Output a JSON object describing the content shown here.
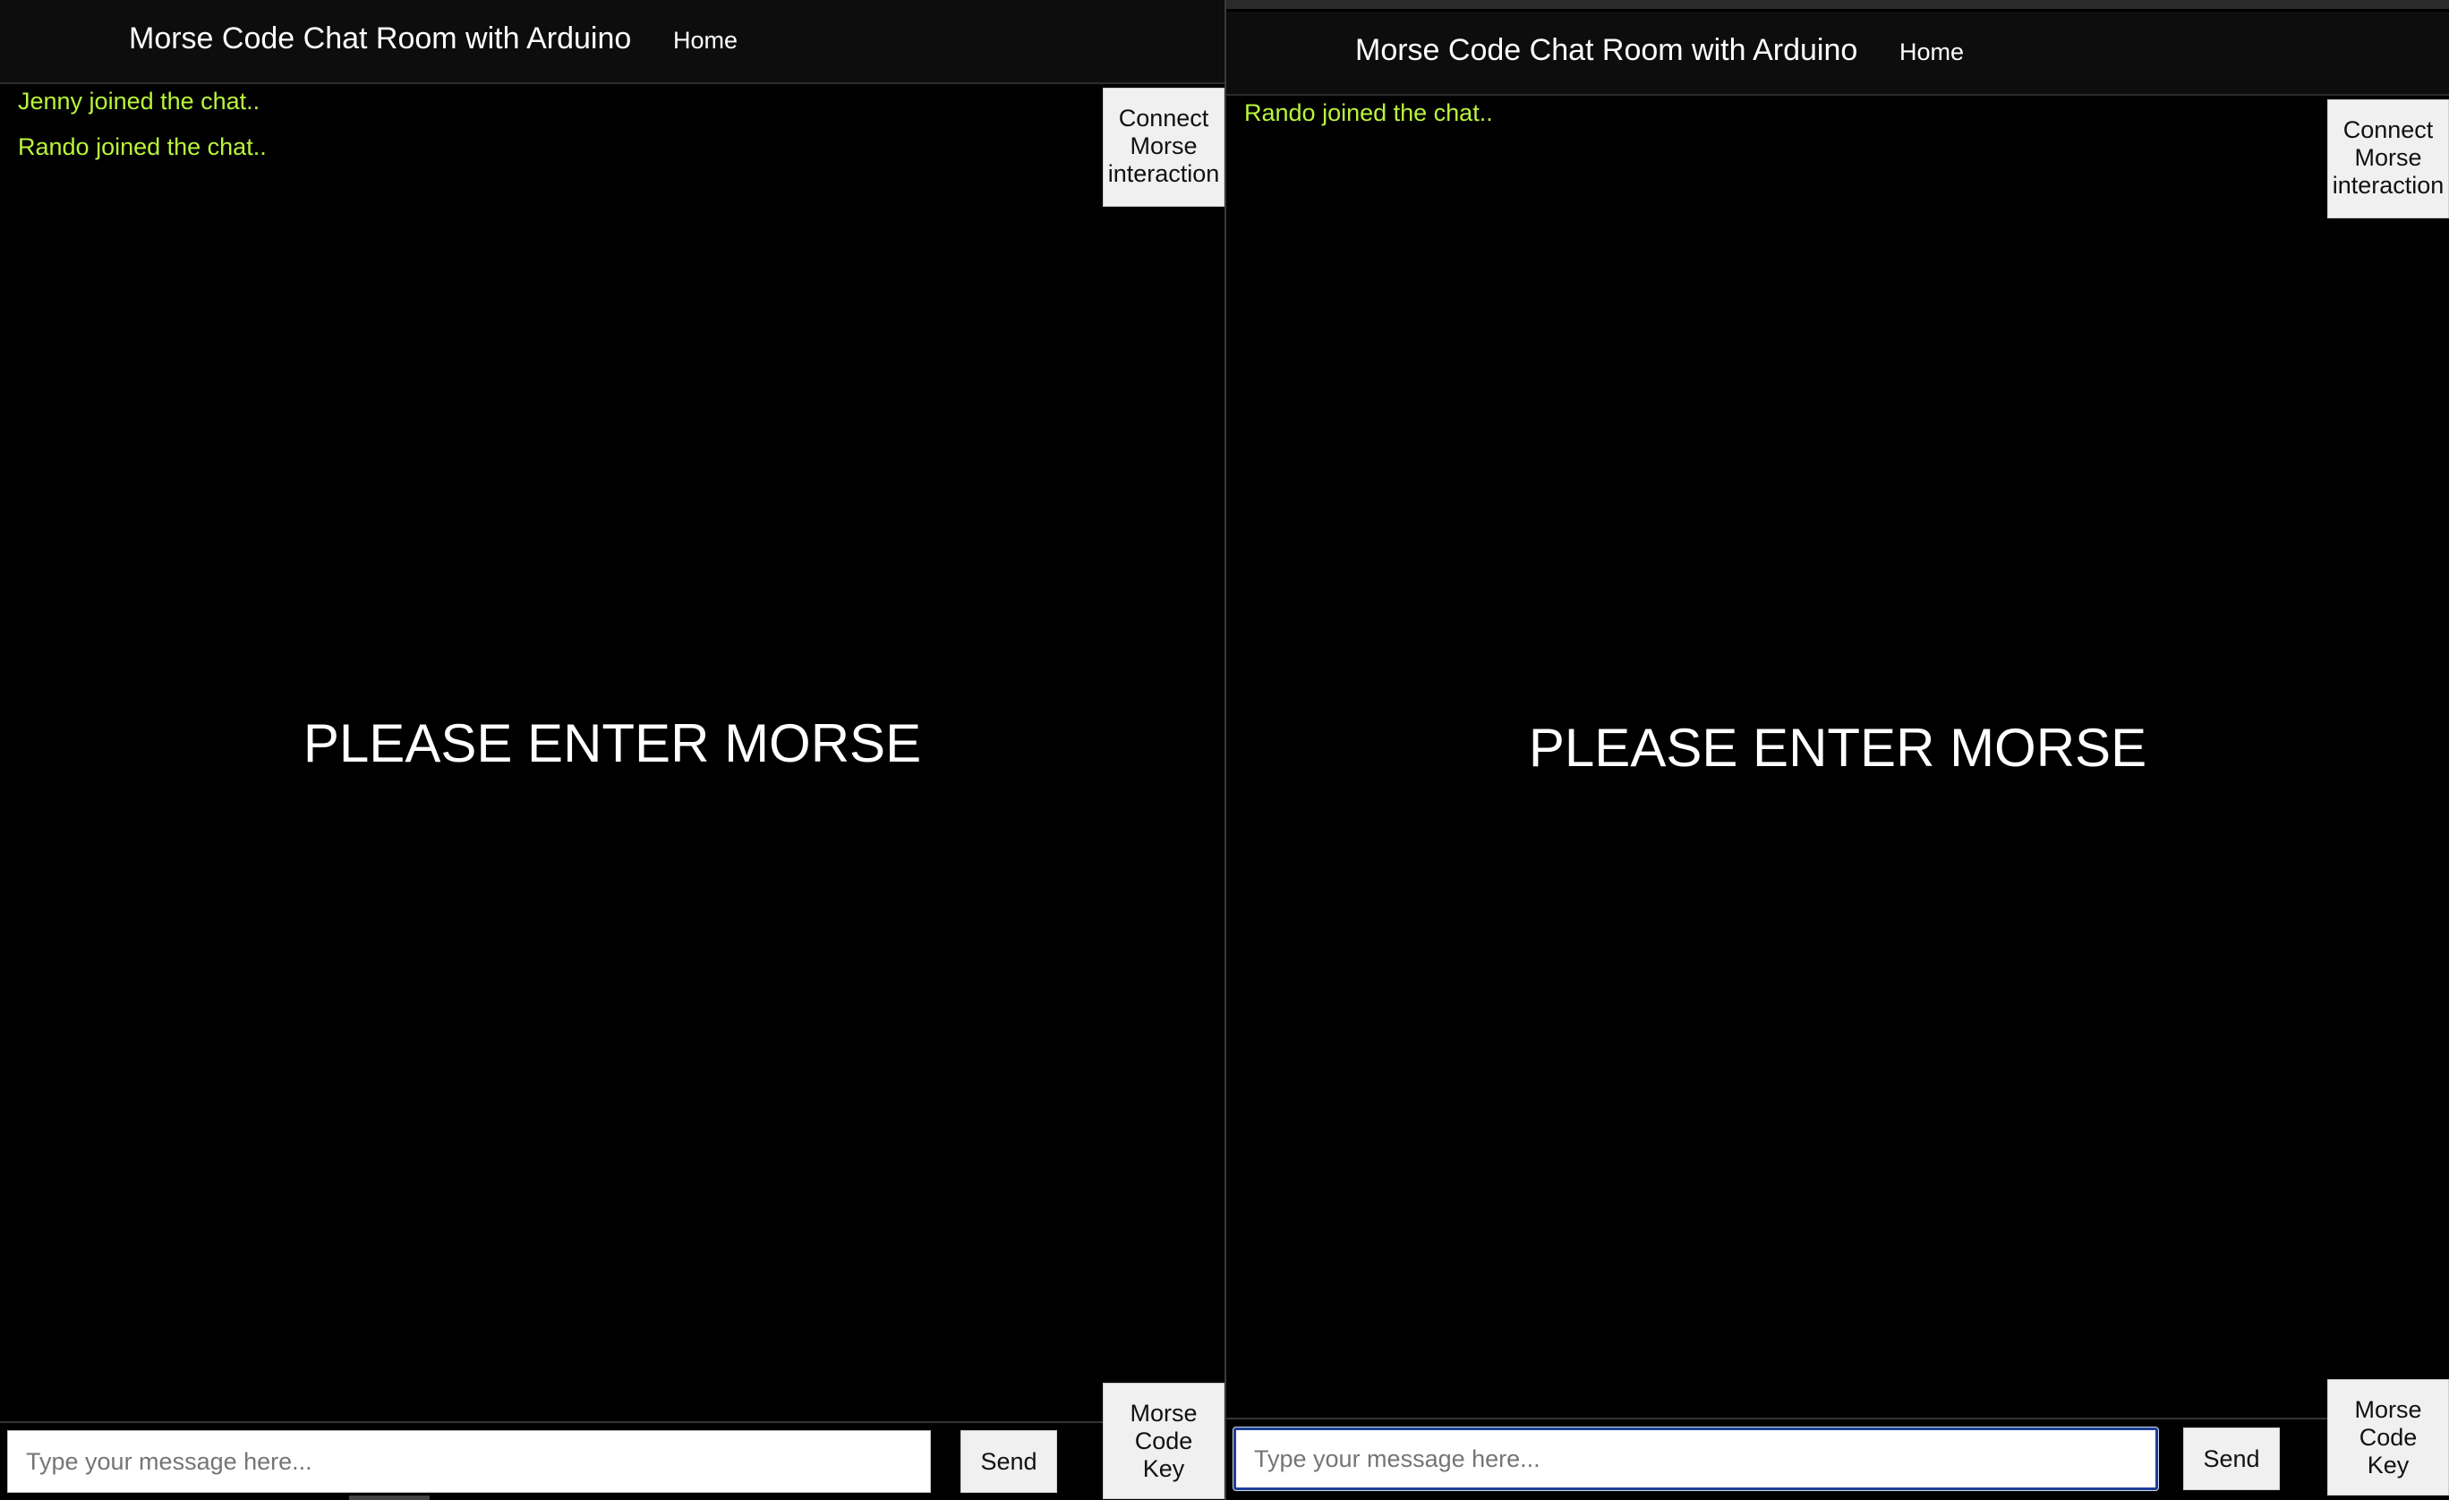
{
  "left_window": {
    "nav": {
      "title": "Morse Code Chat Room with Arduino",
      "home": "Home"
    },
    "messages": [
      "Jenny joined the chat..",
      "Rando joined the chat.."
    ],
    "connect_button": "Connect\nMorse\ninteraction",
    "main_prompt": "PLEASE ENTER MORSE",
    "input": {
      "placeholder": "Type your message here...",
      "value": ""
    },
    "send_button": "Send",
    "key_button": "Morse\nCode\nKey"
  },
  "right_window": {
    "nav": {
      "title": "Morse Code Chat Room with Arduino",
      "home": "Home"
    },
    "messages": [
      "Rando joined the chat.."
    ],
    "connect_button": "Connect\nMorse\ninteraction",
    "main_prompt": "PLEASE ENTER MORSE",
    "input": {
      "placeholder": "Type your message here...",
      "value": "",
      "focused": true
    },
    "send_button": "Send",
    "key_button": "Morse\nCode\nKey"
  },
  "colors": {
    "background": "#000000",
    "navbar": "#0d0d0d",
    "system_message": "#b9f53c",
    "text": "#ffffff",
    "button": "#f0f0f0",
    "focus_border": "#1c3f94"
  }
}
